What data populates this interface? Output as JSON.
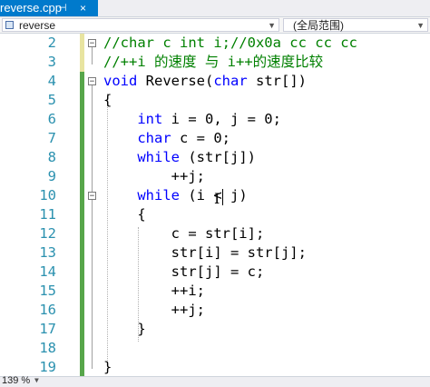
{
  "tab": {
    "filename": "reverse.cpp",
    "pin": "⊣",
    "close": "×"
  },
  "navbar": {
    "scope": "reverse",
    "global": "(全局范围)"
  },
  "editor": {
    "lines": [
      {
        "num": "2",
        "tokens": [
          {
            "t": "//char c int i;//0x0a cc cc cc",
            "c": "cm"
          }
        ]
      },
      {
        "num": "3",
        "tokens": [
          {
            "t": "//++i 的速度 与 i++的速度比较",
            "c": "cm"
          }
        ]
      },
      {
        "num": "4",
        "tokens": [
          {
            "t": "void",
            "c": "kw"
          },
          {
            "t": " Reverse("
          },
          {
            "t": "char",
            "c": "kw"
          },
          {
            "t": " str[])"
          }
        ]
      },
      {
        "num": "5",
        "tokens": [
          {
            "t": "{"
          }
        ]
      },
      {
        "num": "6",
        "tokens": [
          {
            "t": "    "
          },
          {
            "t": "int",
            "c": "kw"
          },
          {
            "t": " i = 0, j = 0;"
          }
        ]
      },
      {
        "num": "7",
        "tokens": [
          {
            "t": "    "
          },
          {
            "t": "char",
            "c": "kw"
          },
          {
            "t": " c = 0;"
          }
        ]
      },
      {
        "num": "8",
        "tokens": [
          {
            "t": "    "
          },
          {
            "t": "while",
            "c": "kw"
          },
          {
            "t": " (str[j])"
          }
        ]
      },
      {
        "num": "9",
        "tokens": [
          {
            "t": "        ++j;"
          }
        ]
      },
      {
        "num": "10",
        "tokens": [
          {
            "t": "    "
          },
          {
            "t": "while",
            "c": "kw"
          },
          {
            "t": " (i < j)"
          }
        ]
      },
      {
        "num": "11",
        "tokens": [
          {
            "t": "    {"
          }
        ]
      },
      {
        "num": "12",
        "tokens": [
          {
            "t": "        c = str[i];"
          }
        ]
      },
      {
        "num": "13",
        "tokens": [
          {
            "t": "        str[i] = str[j];"
          }
        ]
      },
      {
        "num": "14",
        "tokens": [
          {
            "t": "        str[j] = c;"
          }
        ]
      },
      {
        "num": "15",
        "tokens": [
          {
            "t": "        ++i;"
          }
        ]
      },
      {
        "num": "16",
        "tokens": [
          {
            "t": "        ++j;"
          }
        ]
      },
      {
        "num": "17",
        "tokens": [
          {
            "t": "    }"
          }
        ]
      },
      {
        "num": "18",
        "tokens": [
          {
            "t": ""
          }
        ]
      },
      {
        "num": "19",
        "tokens": [
          {
            "t": "}"
          }
        ]
      }
    ]
  },
  "status": {
    "zoom": "139 %"
  },
  "colors": {
    "accent": "#007acc",
    "keyword": "#0000ff",
    "comment": "#008000",
    "line_number": "#2b91af",
    "changed_bar": "#57a64a"
  }
}
